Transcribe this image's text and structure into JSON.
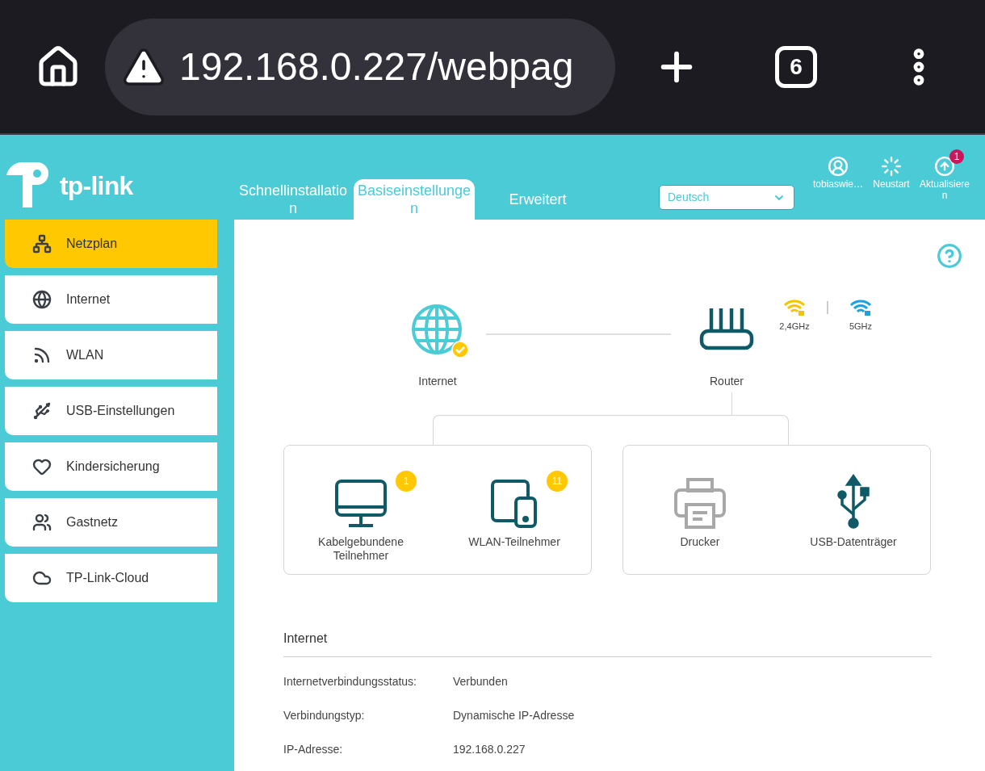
{
  "browser": {
    "url": "192.168.0.227/webpag",
    "tab_count": "6"
  },
  "brand": "tp-link",
  "header": {
    "tabs": [
      {
        "label": "Schnellinstallation",
        "selected": false
      },
      {
        "label": "Basiseinstellungen",
        "selected": true
      },
      {
        "label": "Erweitert",
        "selected": false
      }
    ],
    "language": "Deutsch",
    "actions": [
      {
        "kind": "user",
        "label": "tobiaswie…"
      },
      {
        "kind": "restart",
        "label": "Neustart"
      },
      {
        "kind": "update",
        "label": "Aktualisieren",
        "badge": "1"
      }
    ]
  },
  "sidebar": {
    "items": [
      {
        "kind": "map",
        "label": "Netzplan",
        "selected": true
      },
      {
        "kind": "globe",
        "label": "Internet",
        "selected": false
      },
      {
        "kind": "wifi",
        "label": "WLAN",
        "selected": false
      },
      {
        "kind": "usb",
        "label": "USB-Einstellungen",
        "selected": false
      },
      {
        "kind": "heart",
        "label": "Kindersicherung",
        "selected": false
      },
      {
        "kind": "guests",
        "label": "Gastnetz",
        "selected": false
      },
      {
        "kind": "cloud",
        "label": "TP-Link-Cloud",
        "selected": false
      }
    ]
  },
  "network_map": {
    "internet": {
      "label": "Internet",
      "connected": true
    },
    "router": {
      "label": "Router"
    },
    "bands": [
      {
        "label": "2,4GHz",
        "color": "#f5c400"
      },
      {
        "label": "5GHz",
        "color": "#1aa3e0"
      }
    ],
    "groups": [
      [
        {
          "kind": "wired",
          "label": "Kabelgebundene Teilnehmer",
          "badge": "1",
          "active": true
        },
        {
          "kind": "wireless",
          "label": "WLAN-Teilnehmer",
          "badge": "11",
          "active": true
        }
      ],
      [
        {
          "kind": "printer",
          "label": "Drucker",
          "active": false
        },
        {
          "kind": "usb",
          "label": "USB-Datenträger",
          "active": true
        }
      ]
    ]
  },
  "info": {
    "title": "Internet",
    "rows": [
      {
        "label": "Internetverbindungsstatus:",
        "value": "Verbunden"
      },
      {
        "label": "Verbindungstyp:",
        "value": "Dynamische IP-Adresse"
      },
      {
        "label": "IP-Adresse:",
        "value": "192.168.0.227"
      }
    ]
  }
}
